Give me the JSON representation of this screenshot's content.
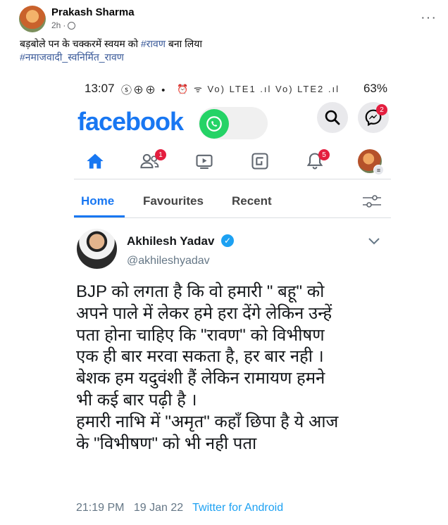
{
  "post": {
    "author": "Prakash Sharma",
    "time": "2h",
    "more_label": "···",
    "text_prefix": "बड़बोले पन के चक्करमें स्वयम को ",
    "text_hashtag": "#रावण",
    "text_suffix": " बना लिया",
    "hashtag_line": "#नमाजवादी_स्वनिर्मित_रावण"
  },
  "phone": {
    "status": {
      "time": "13:07",
      "left_icons": "ⓢ⊕⊕ •",
      "right_icons": "⏰ ᯤ Vo) LTE1 .ıl Vo) LTE2 .ıl",
      "battery": "63%"
    },
    "app": {
      "logo": "facebook",
      "messenger_badge": "2",
      "friends_badge": "1",
      "notifications_badge": "5"
    },
    "tabs": [
      "Home",
      "Favourites",
      "Recent"
    ],
    "tweet": {
      "name": "Akhilesh Yadav",
      "handle": "@akhileshyadav",
      "lines": [
        "BJP को लगता है कि वो हमारी \" बहू\" को",
        "अपने पाले में लेकर हमे हरा देंगे लेकिन उन्हें",
        "पता होना चाहिए कि \"रावण\" को विभीषण",
        "एक ही बार मरवा सकता है, हर बार नही ।",
        "बेशक हम यदुवंशी हैं लेकिन रामायण हमने",
        "भी कई बार पढ़ी है ।",
        "हमारी नाभि में \"अमृत\" कहाँ छिपा है ये आज",
        "के \"विभीषण\" को भी नही पता"
      ],
      "time": "21:19 PM",
      "date": "19 Jan 22",
      "source": "Twitter for Android"
    }
  },
  "colors": {
    "facebook_blue": "#1877f2",
    "whatsapp_green": "#25d366",
    "badge_red": "#e41e3f",
    "twitter_blue": "#1da1f2"
  }
}
